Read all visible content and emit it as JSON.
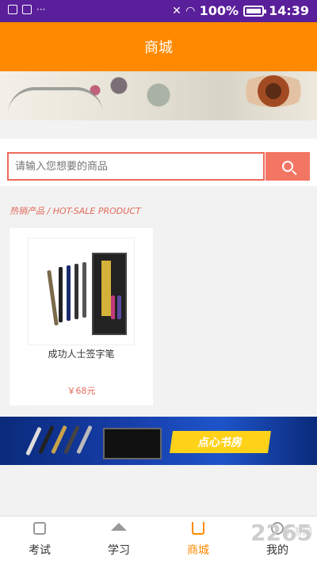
{
  "statusbar": {
    "battery": "100%",
    "time": "14:39",
    "left_dots": "···"
  },
  "header": {
    "title": "商城"
  },
  "search": {
    "placeholder": "请输入您想要的商品"
  },
  "section": {
    "title": "热销产品 / HOT-SALE PRODUCT"
  },
  "products": [
    {
      "name": "成功人士签字笔",
      "price": "￥68元"
    }
  ],
  "promo": {
    "label": "点心书房"
  },
  "tabs": [
    {
      "label": "考试",
      "icon": "checkbox-icon"
    },
    {
      "label": "学习",
      "icon": "graduation-cap-icon"
    },
    {
      "label": "商城",
      "icon": "cart-icon"
    },
    {
      "label": "我的",
      "icon": "person-icon"
    }
  ],
  "watermark": {
    "text": "2265",
    "subtext": "手游网"
  },
  "colors": {
    "accent": "#ff8a00",
    "statusbar": "#5a1f9a",
    "search_border": "#f06a5b",
    "price": "#e06a5a"
  }
}
